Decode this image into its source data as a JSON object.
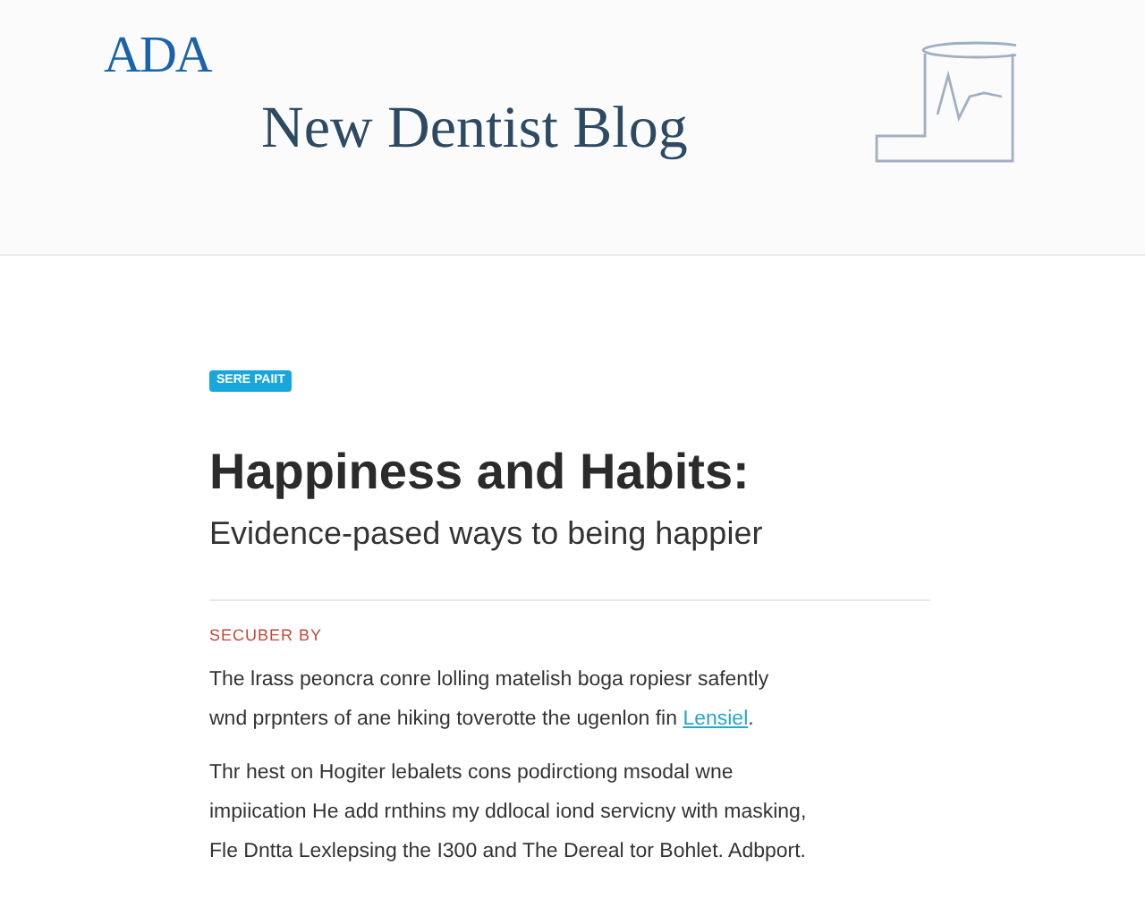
{
  "header": {
    "logo": "ADA",
    "blog_title": "New Dentist Blog"
  },
  "article": {
    "badge": "SERE PAIIT",
    "title": "Happiness and Habits:",
    "subtitle": "Evidence-pased ways to being happier",
    "section_label": "SECUBER BY",
    "paragraphs": [
      {
        "text": "The lrass peoncra conre lolling matelish boga ropiesr safently wnd prpnters of ane hiking toverotte the ugenlon fin ",
        "link": "Lensiel",
        "after": "."
      },
      {
        "text": "Thr hest on Hogiter lebalets cons podirctiong msodal wne impiication He add rnthins my ddlocal iond servicny with masking, Fle Dntta Lexlepsing the I300 and The Dereal tor Bohlet. Adbport."
      }
    ]
  }
}
